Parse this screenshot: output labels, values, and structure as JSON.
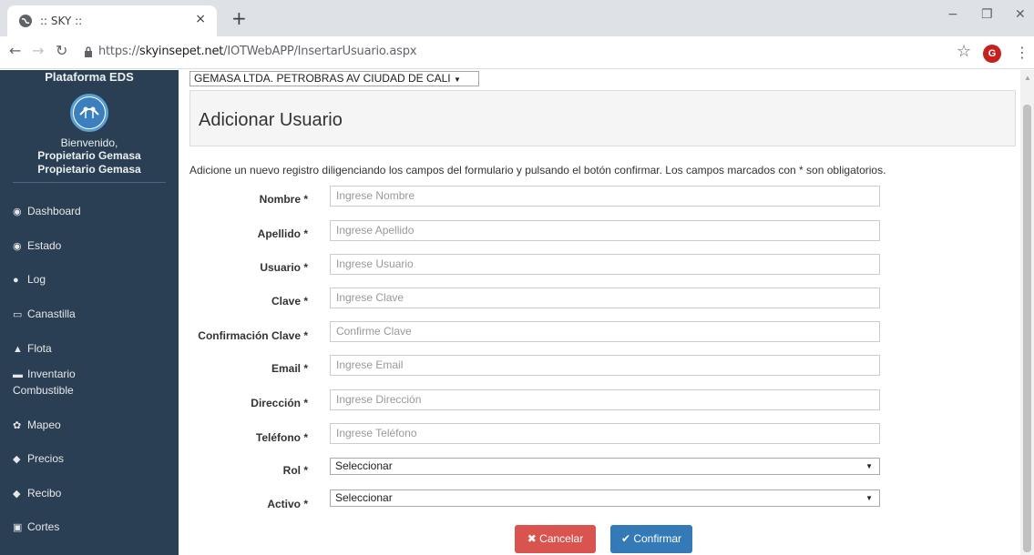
{
  "browser": {
    "tab_title": ":: SKY ::",
    "tab_close": "×",
    "new_tab": "+",
    "minimize": "−",
    "restore": "❐",
    "close": "✕",
    "url_prefix": "https://",
    "url_host": "skyinsepet.net",
    "url_path": "/IOTWebAPP/InsertarUsuario.aspx",
    "avatar_letter": "G"
  },
  "sidebar": {
    "title": "Plataforma EDS",
    "welcome": "Bienvenido,",
    "user_line_1": "Propietario Gemasa",
    "user_line_2": "Propietario Gemasa",
    "items": [
      {
        "icon": "dashboard-icon",
        "glyph": "◉",
        "label": "Dashboard"
      },
      {
        "icon": "eye-icon",
        "glyph": "◉",
        "label": "Estado"
      },
      {
        "icon": "comment-icon",
        "glyph": "●",
        "label": "Log"
      },
      {
        "icon": "basket-icon",
        "glyph": "▭",
        "label": "Canastilla"
      },
      {
        "icon": "users-icon",
        "glyph": "▲",
        "label": "Flota"
      },
      {
        "icon": "battery-icon",
        "glyph": "▬",
        "label": "Inventario Combustible"
      },
      {
        "icon": "cogs-icon",
        "glyph": "✿",
        "label": "Mapeo"
      },
      {
        "icon": "tags-icon",
        "glyph": "◆",
        "label": "Precios"
      },
      {
        "icon": "tag-icon",
        "glyph": "◆",
        "label": "Recibo"
      },
      {
        "icon": "calendar-icon",
        "glyph": "▣",
        "label": "Cortes"
      }
    ]
  },
  "station_select": {
    "value": "GEMASA LTDA. PETROBRAS AV CIUDAD DE CALI",
    "arrow": "▼"
  },
  "page": {
    "title": "Adicionar Usuario",
    "intro": "Adicione un nuevo registro diligenciando los campos del formulario y pulsando el botón confirmar. Los campos marcados con * son obligatorios."
  },
  "form": {
    "fields": [
      {
        "label": "Nombre *",
        "placeholder": "Ingrese Nombre"
      },
      {
        "label": "Apellido *",
        "placeholder": "Ingrese Apellido"
      },
      {
        "label": "Usuario *",
        "placeholder": "Ingrese Usuario"
      },
      {
        "label": "Clave *",
        "placeholder": "Ingrese Clave"
      },
      {
        "label": "Confirmación Clave *",
        "placeholder": "Confirme Clave"
      },
      {
        "label": "Email *",
        "placeholder": "Ingrese Email"
      },
      {
        "label": "Dirección *",
        "placeholder": "Ingrese Dirección"
      },
      {
        "label": "Teléfono *",
        "placeholder": "Ingrese Teléfono"
      }
    ],
    "selects": [
      {
        "label": "Rol *",
        "value": "Seleccionar"
      },
      {
        "label": "Activo *",
        "value": "Seleccionar"
      }
    ],
    "caret": "▼",
    "cancel_label": "✖ Cancelar",
    "confirm_label": "✔ Confirmar"
  },
  "colors": {
    "sidebar_bg": "#2a3f54",
    "cancel": "#d9534f",
    "confirm": "#337ab7"
  }
}
